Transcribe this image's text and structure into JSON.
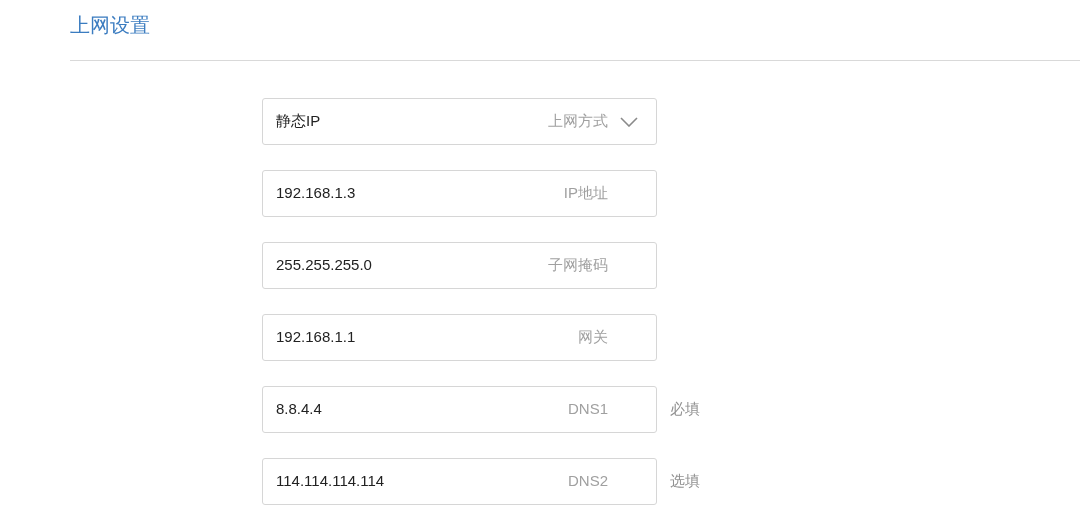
{
  "section": {
    "title": "上网设置"
  },
  "fields": [
    {
      "kind": "select",
      "value": "静态IP",
      "label": "上网方式"
    },
    {
      "kind": "input",
      "value": "192.168.1.3",
      "label": "IP地址"
    },
    {
      "kind": "input",
      "value": "255.255.255.0",
      "label": "子网掩码"
    },
    {
      "kind": "input",
      "value": "192.168.1.1",
      "label": "网关"
    },
    {
      "kind": "input",
      "value": "8.8.4.4",
      "label": "DNS1",
      "note": "必填"
    },
    {
      "kind": "input",
      "value": "114.114.114.114",
      "label": "DNS2",
      "note": "选填"
    }
  ]
}
